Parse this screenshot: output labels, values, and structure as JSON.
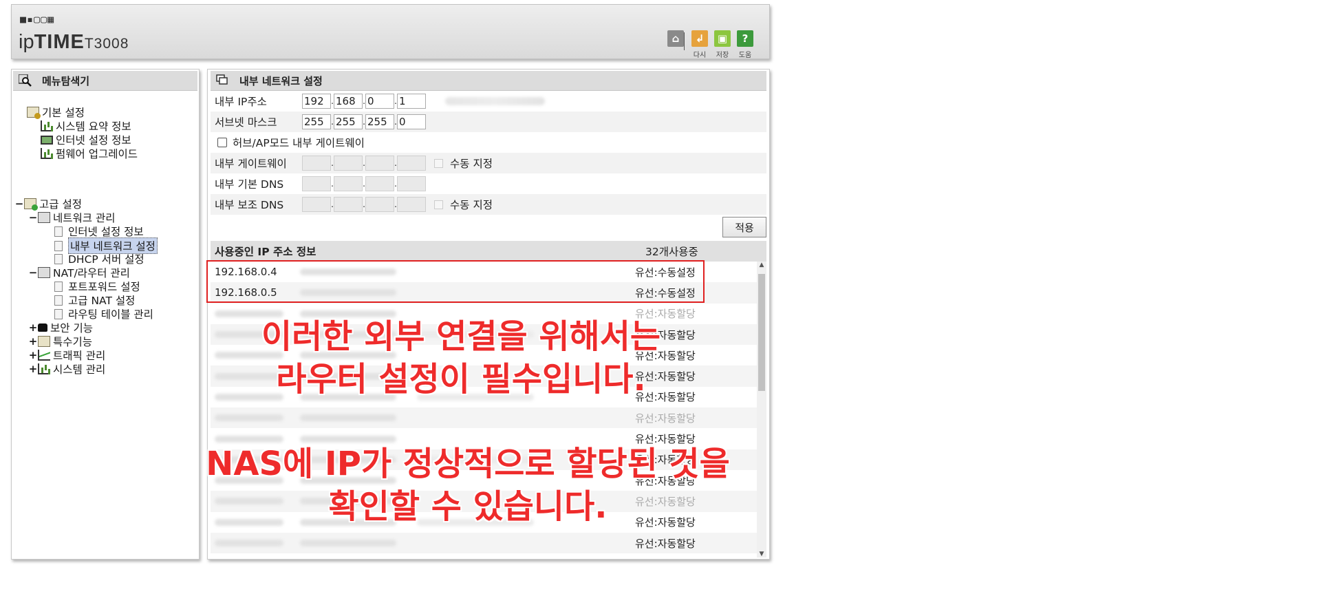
{
  "header": {
    "logo_dots": "■▪▢▢▦",
    "brand_ip": "ip",
    "brand_time": "TIME",
    "model": "T3008",
    "buttons": [
      {
        "name": "home",
        "label": "",
        "color": "#8a8a8a"
      },
      {
        "name": "back",
        "label": "다시",
        "color": "#e6a23c"
      },
      {
        "name": "save",
        "label": "저장",
        "color": "#8cc63f"
      },
      {
        "name": "help",
        "label": "도움",
        "color": "#3c9a3c"
      }
    ]
  },
  "sidebar": {
    "title": "메뉴탐색기",
    "groups": {
      "basic": {
        "label": "기본 설정",
        "items": [
          "시스템 요약 정보",
          "인터넷 설정 정보",
          "펌웨어 업그레이드"
        ]
      },
      "advanced": {
        "label": "고급 설정",
        "toggle": "−"
      },
      "network": {
        "label": "네트워크 관리",
        "toggle": "−",
        "items": [
          "인터넷 설정 정보",
          "내부 네트워크 설정",
          "DHCP 서버 설정"
        ]
      },
      "nat": {
        "label": "NAT/라우터 관리",
        "toggle": "−",
        "items": [
          "포트포워드 설정",
          "고급 NAT 설정",
          "라우팅 테이블 관리"
        ]
      },
      "security": {
        "label": "보안 기능",
        "toggle": "+"
      },
      "special": {
        "label": "특수기능",
        "toggle": "+"
      },
      "traffic": {
        "label": "트래픽 관리",
        "toggle": "+"
      },
      "system": {
        "label": "시스템 관리",
        "toggle": "+"
      }
    }
  },
  "main": {
    "title": "내부 네트워크 설정",
    "ip_label": "내부 IP주소",
    "ip": [
      "192",
      "168",
      "0",
      "1"
    ],
    "subnet_label": "서브넷 마스크",
    "subnet": [
      "255",
      "255",
      "255",
      "0"
    ],
    "hub_mode_label": "허브/AP모드 내부 게이트웨이",
    "gateway_label": "내부 게이트웨이",
    "manual_label": "수동 지정",
    "dns1_label": "내부 기본 DNS",
    "dns2_label": "내부 보조 DNS",
    "apply_label": "적용",
    "ip_info_title": "사용중인 IP 주소 정보",
    "ip_count": "32개사용중",
    "ip_rows": [
      {
        "ip": "192.168.0.4",
        "type": "유선:수동설정",
        "faint": false,
        "blur_ip": false
      },
      {
        "ip": "192.168.0.5",
        "type": "유선:수동설정",
        "faint": false,
        "blur_ip": false
      },
      {
        "ip": "",
        "type": "유선:자동할당",
        "faint": true,
        "blur_ip": true
      },
      {
        "ip": "",
        "type": "유선:자동할당",
        "faint": false,
        "blur_ip": true
      },
      {
        "ip": "",
        "type": "유선:자동할당",
        "faint": false,
        "blur_ip": true
      },
      {
        "ip": "",
        "type": "유선:자동할당",
        "faint": false,
        "blur_ip": true
      },
      {
        "ip": "",
        "type": "유선:자동할당",
        "faint": false,
        "blur_ip": true
      },
      {
        "ip": "",
        "type": "유선:자동할당",
        "faint": true,
        "blur_ip": true
      },
      {
        "ip": "",
        "type": "유선:자동할당",
        "faint": false,
        "blur_ip": true
      },
      {
        "ip": "",
        "type": "유선:자동할당",
        "faint": false,
        "blur_ip": true
      },
      {
        "ip": "",
        "type": "유선:자동할당",
        "faint": false,
        "blur_ip": true
      },
      {
        "ip": "",
        "type": "유선:자동할당",
        "faint": true,
        "blur_ip": true
      },
      {
        "ip": "",
        "type": "유선:자동할당",
        "faint": false,
        "blur_ip": true
      },
      {
        "ip": "",
        "type": "유선:자동할당",
        "faint": false,
        "blur_ip": true
      }
    ]
  },
  "captions": {
    "line1": "이러한 외부 연결을 위해서는",
    "line2": "라우터 설정이 필수입니다.",
    "line3": "NAS에 IP가 정상적으로 할당된 것을",
    "line4": "확인할 수 있습니다."
  },
  "colors": {
    "highlight_box": "#e02020",
    "caption": "#ee2b2b",
    "selected_item": "#c7d4ee"
  }
}
